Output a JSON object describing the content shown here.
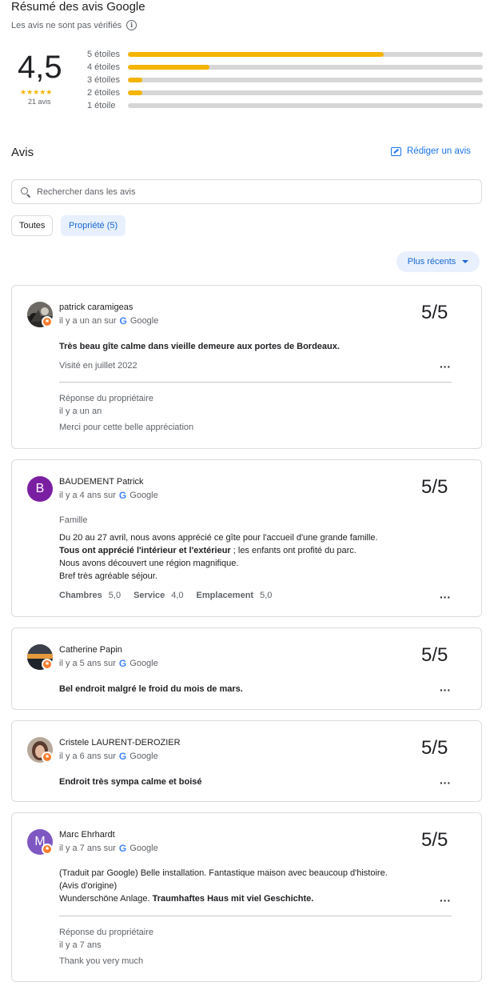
{
  "header": {
    "title": "Résumé des avis Google",
    "subtitle": "Les avis ne sont pas vérifiés"
  },
  "summary": {
    "score": "4,5",
    "stars": "★★★★★",
    "count": "21 avis",
    "bars": [
      {
        "label": "5 étoiles",
        "fraction": 0.72
      },
      {
        "label": "4 étoiles",
        "fraction": 0.23
      },
      {
        "label": "3 étoiles",
        "fraction": 0.04
      },
      {
        "label": "2 étoiles",
        "fraction": 0.04
      },
      {
        "label": "1 étoile",
        "fraction": 0.0
      }
    ]
  },
  "reviews_section": {
    "title": "Avis",
    "write_label": "Rédiger un avis",
    "search_placeholder": "Rechercher dans les avis",
    "chips": [
      "Toutes",
      "Propriété (5)"
    ],
    "sort_label": "Plus récents"
  },
  "reviews": [
    {
      "name": "patrick caramigeas",
      "when": "il y a un an sur",
      "source": "Google",
      "score": "5/5",
      "text": "Très beau gîte calme dans vieille demeure aux portes de Bordeaux.",
      "visited": "Visité en juillet 2022",
      "reply_label": "Réponse du propriétaire",
      "reply_when": "il y a un an",
      "reply_text": "Merci pour cette belle appréciation"
    },
    {
      "name": "BAUDEMENT Patrick",
      "initial": "B",
      "when": "il y a 4 ans sur",
      "source": "Google",
      "score": "5/5",
      "trip_type": "Famille",
      "line1": "Du 20 au 27 avril, nous avons apprécié ce gîte pour l'accueil d'une grande famille.",
      "line2_bold": "Tous ont apprécié l'intérieur et l'extérieur",
      "line2_rest": " ; les enfants ont profité du parc.",
      "line3": "Nous avons découvert une région magnifique.",
      "line4": "Bref très agréable séjour.",
      "sub_ratings": [
        {
          "label": "Chambres",
          "value": "5,0"
        },
        {
          "label": "Service",
          "value": "4,0"
        },
        {
          "label": "Emplacement",
          "value": "5,0"
        }
      ]
    },
    {
      "name": "Catherine Papin",
      "when": "il y a 5 ans sur",
      "source": "Google",
      "score": "5/5",
      "text": "Bel endroit malgré le froid du mois de mars."
    },
    {
      "name": "Cristele LAURENT-DEROZIER",
      "when": "il y a 6 ans sur",
      "source": "Google",
      "score": "5/5",
      "text": "Endroit très sympa calme et boisé"
    },
    {
      "name": "Marc Ehrhardt",
      "initial": "M",
      "when": "il y a 7 ans sur",
      "source": "Google",
      "score": "5/5",
      "line1": "(Traduit par Google) Belle installation. Fantastique maison avec beaucoup d'histoire.",
      "line2": "(Avis d'origine)",
      "line3_plain": "Wunderschöne Anlage. ",
      "line3_bold": "Traumhaftes Haus mit viel Geschichte.",
      "reply_label": "Réponse du propriétaire",
      "reply_when": "il y a 7 ans",
      "reply_text": "Thank you very much"
    }
  ],
  "colors": {
    "star": "#f4b400",
    "accent": "#1a73e8",
    "badge": "#f87b2c",
    "avatar_b": "#7b1fa2",
    "avatar_m": "#7e57c2"
  },
  "icons": {
    "info": "info-icon",
    "write": "rate-review-icon",
    "search": "search-icon",
    "google": "google-g-icon",
    "more": "more-horiz-icon",
    "sort_caret": "caret-down-icon",
    "local_guide": "local-guide-badge-icon"
  }
}
